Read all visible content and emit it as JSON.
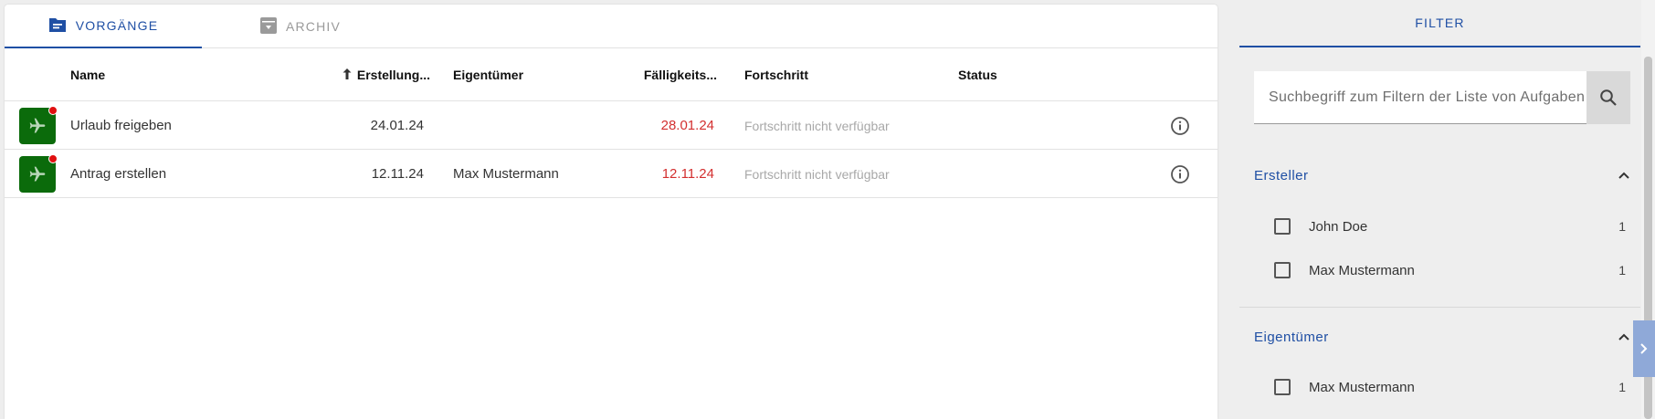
{
  "tabs": {
    "active": {
      "label": "VORGÄNGE",
      "icon": "folder-list-icon"
    },
    "inactive": {
      "label": "ARCHIV",
      "icon": "archive-icon"
    }
  },
  "table": {
    "headers": {
      "name": "Name",
      "created": "Erstellung...",
      "owner": "Eigentümer",
      "due": "Fälligkeits...",
      "progress": "Fortschritt",
      "status": "Status"
    },
    "rows": [
      {
        "name": "Urlaub freigeben",
        "created": "24.01.24",
        "owner": "",
        "due": "28.01.24",
        "progress": "Fortschritt nicht verfügbar",
        "status": ""
      },
      {
        "name": "Antrag erstellen",
        "created": "12.11.24",
        "owner": "Max Mustermann",
        "due": "12.11.24",
        "progress": "Fortschritt nicht verfügbar",
        "status": ""
      }
    ]
  },
  "filter": {
    "title": "FILTER",
    "search_placeholder": "Suchbegriff zum Filtern der Liste von Aufgaben",
    "sections": [
      {
        "title": "Ersteller",
        "options": [
          {
            "label": "John Doe",
            "count": "1"
          },
          {
            "label": "Max Mustermann",
            "count": "1"
          }
        ]
      },
      {
        "title": "Eigentümer",
        "options": [
          {
            "label": "Max Mustermann",
            "count": "1"
          }
        ]
      }
    ]
  },
  "colors": {
    "accent": "#1f4fa4",
    "row_icon_bg": "#0b6b0b",
    "notification_dot": "#e01010",
    "due_date": "#d32f2f"
  }
}
